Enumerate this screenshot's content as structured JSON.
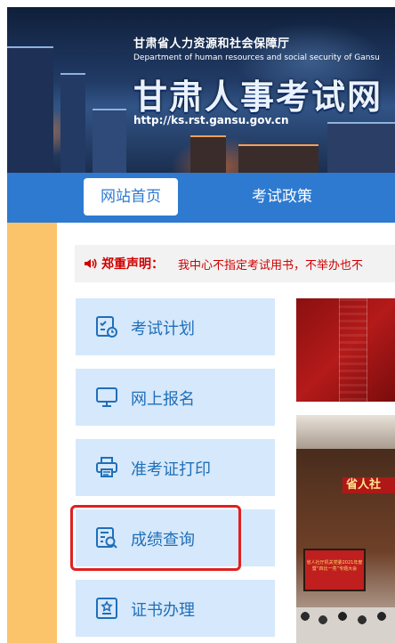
{
  "header": {
    "org_name_cn": "甘肃省人力资源和社会保障厅",
    "org_name_en": "Department of human resources and social security of Gansu",
    "site_title": "甘肃人事考试网",
    "site_url": "http://ks.rst.gansu.gov.cn"
  },
  "nav": {
    "tabs": [
      {
        "label": "网站首页",
        "active": true
      },
      {
        "label": "考试政策",
        "active": false
      }
    ]
  },
  "notice": {
    "label": "郑重声明：",
    "text": "我中心不指定考试用书，不举办也不"
  },
  "menu": {
    "items": [
      {
        "label": "考试计划",
        "icon": "calendar-check-icon"
      },
      {
        "label": "网上报名",
        "icon": "monitor-icon"
      },
      {
        "label": "准考证打印",
        "icon": "printer-icon"
      },
      {
        "label": "成绩查询",
        "icon": "document-search-icon",
        "highlighted": true
      },
      {
        "label": "证书办理",
        "icon": "certificate-icon"
      }
    ]
  },
  "images": {
    "meeting_banner_text": "省人社",
    "meeting_screen_text": "省人社厅机关党委2021年度 暨“四比一亮”专题大会"
  },
  "colors": {
    "nav_blue": "#2d7ad0",
    "menu_bg": "#d6e8fb",
    "menu_text": "#1f6fb8",
    "notice_red": "#d00000",
    "side_orange": "#fbc46a",
    "highlight_red": "#e02020"
  }
}
